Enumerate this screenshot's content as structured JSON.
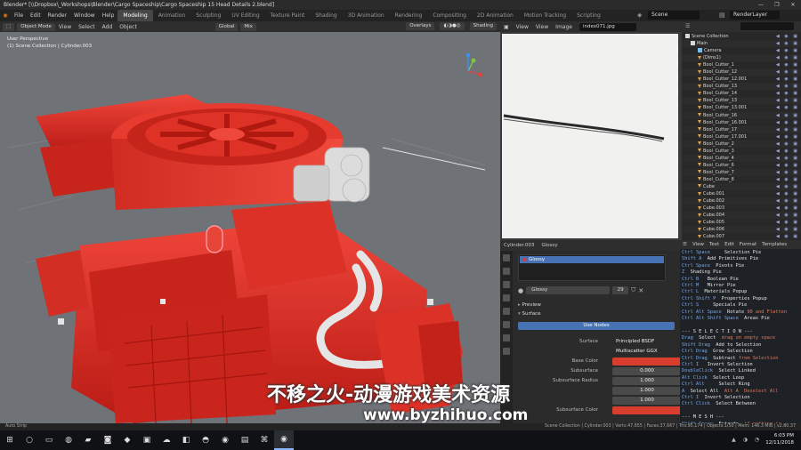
{
  "window": {
    "title": "Blender* [\\\\Dropbox\\_Workshops\\Blender\\Cargo Spaceship\\Cargo Spaceship 15 Head Details 2.blend]",
    "controls": [
      "—",
      "❐",
      "✕"
    ]
  },
  "menu": [
    "File",
    "Edit",
    "Render",
    "Window",
    "Help"
  ],
  "workspaces": [
    "Modeling",
    "Animation",
    "Sculpting",
    "UV Editing",
    "Texture Paint",
    "Shading",
    "3D Animation",
    "Rendering",
    "Compositing",
    "2D Animation",
    "Scripting",
    "Motion Tracking",
    "Scripting"
  ],
  "active_workspace": "Modeling",
  "scene": "Scene",
  "render_layer": "RenderLayer",
  "viewport": {
    "mode": "Object Mode",
    "menus": [
      "View",
      "Select",
      "Add",
      "Object"
    ],
    "transform_orientation": "Global",
    "pivot": "Mix",
    "overlays": "Overlays",
    "shading": "Shading",
    "info_line1": "User Perspective",
    "info_line2": "(1) Scene Collection | Cylinder.003",
    "accent_color": "#e3231b"
  },
  "image_editor": {
    "menus": [
      "View",
      "View",
      "Image"
    ],
    "filename": "index071.jpg"
  },
  "outliner": {
    "items": [
      {
        "label": "Scene Collection",
        "icon": "collection"
      },
      {
        "label": "Main",
        "icon": "collection"
      },
      {
        "label": "Camera",
        "icon": "camera"
      },
      {
        "label": "(Dims1)",
        "icon": "mesh"
      },
      {
        "label": "Bool_Cutter_1",
        "icon": "mesh"
      },
      {
        "label": "Bool_Cutter_12",
        "icon": "mesh"
      },
      {
        "label": "Bool_Cutter_12.001",
        "icon": "mesh"
      },
      {
        "label": "Bool_Cutter_13",
        "icon": "mesh"
      },
      {
        "label": "Bool_Cutter_14",
        "icon": "mesh"
      },
      {
        "label": "Bool_Cutter_13",
        "icon": "mesh"
      },
      {
        "label": "Bool_Cutter_13.001",
        "icon": "mesh"
      },
      {
        "label": "Bool_Cutter_16",
        "icon": "mesh"
      },
      {
        "label": "Bool_Cutter_16.001",
        "icon": "mesh"
      },
      {
        "label": "Bool_Cutter_17",
        "icon": "mesh"
      },
      {
        "label": "Bool_Cutter_17.001",
        "icon": "mesh"
      },
      {
        "label": "Bool_Cutter_2",
        "icon": "mesh"
      },
      {
        "label": "Bool_Cutter_3",
        "icon": "mesh"
      },
      {
        "label": "Bool_Cutter_4",
        "icon": "mesh"
      },
      {
        "label": "Bool_Cutter_6",
        "icon": "mesh"
      },
      {
        "label": "Bool_Cutter_7",
        "icon": "mesh"
      },
      {
        "label": "Bool_Cutter_8",
        "icon": "mesh"
      },
      {
        "label": "Cube",
        "icon": "mesh"
      },
      {
        "label": "Cube.001",
        "icon": "mesh"
      },
      {
        "label": "Cube.002",
        "icon": "mesh"
      },
      {
        "label": "Cube.003",
        "icon": "mesh"
      },
      {
        "label": "Cube.004",
        "icon": "mesh"
      },
      {
        "label": "Cube.005",
        "icon": "mesh"
      },
      {
        "label": "Cube.006",
        "icon": "mesh"
      },
      {
        "label": "Cube.007",
        "icon": "mesh"
      }
    ]
  },
  "properties": {
    "breadcrumb_object": "Cylinder.003",
    "breadcrumb_material": "Glossy",
    "slot_name": "Glossy",
    "material_name": "Glossy",
    "users": "29",
    "sections": {
      "preview": "Preview",
      "surface": "Surface"
    },
    "use_nodes": "Use Nodes",
    "rows": [
      {
        "label": "Surface",
        "value": "Principled BSDF",
        "kind": "dd"
      },
      {
        "label": "",
        "value": "Multiscatter GGX",
        "kind": "dd"
      },
      {
        "label": "Base Color",
        "value": "",
        "kind": "red"
      },
      {
        "label": "Subsurface",
        "value": "0.000",
        "kind": "num"
      },
      {
        "label": "Subsurface Radius",
        "value": "1.000",
        "kind": "num"
      },
      {
        "label": "",
        "value": "1.000",
        "kind": "num"
      },
      {
        "label": "",
        "value": "1.000",
        "kind": "num"
      },
      {
        "label": "Subsurface Color",
        "value": "",
        "kind": "red"
      }
    ]
  },
  "text_editor": {
    "menus": [
      "View",
      "Text",
      "Edit",
      "Format",
      "Templates"
    ],
    "lines": [
      {
        "k": "Ctrl Space",
        "t": "     Selection Pie",
        "r": ""
      },
      {
        "k": "Shift A",
        "t": "  Add Primitives Pie",
        "r": ""
      },
      {
        "k": "Ctrl Space",
        "t": "  Pivots Pie",
        "r": ""
      },
      {
        "k": "Z",
        "t": "  Shading Pie",
        "r": ""
      },
      {
        "k": "Ctrl B",
        "t": "   Boolean Pie",
        "r": ""
      },
      {
        "k": "Ctrl M",
        "t": "   Mirror Pie",
        "r": ""
      },
      {
        "k": "Ctrl L",
        "t": "  Materials Popup",
        "r": ""
      },
      {
        "k": "Ctrl Shift P",
        "t": "  Properties Popup",
        "r": ""
      },
      {
        "k": "Ctrl S",
        "t": "     Specials Pie",
        "r": ""
      },
      {
        "k": "Ctrl Alt Space",
        "t": "  Rotate ",
        "r": "90 and Flatten"
      },
      {
        "k": "Ctrl Alt Shift Space",
        "t": "  Areas Pie",
        "r": ""
      },
      {
        "k": "",
        "t": "",
        "r": ""
      },
      {
        "k": "",
        "t": "--- S E L E C T I O N ---",
        "r": ""
      },
      {
        "k": "Drag",
        "t": "  Select  ",
        "r": "drag on empty space"
      },
      {
        "k": "Shift Drag",
        "t": "  Add to Selection",
        "r": ""
      },
      {
        "k": "Ctrl Drag",
        "t": "  Grow Selection",
        "r": ""
      },
      {
        "k": "Ctrl Drag",
        "t": "  Subtract ",
        "r": "from Selection"
      },
      {
        "k": "Ctrl I",
        "t": "   Invert Selection",
        "r": ""
      },
      {
        "k": "DoubleClick",
        "t": "  Select Linked",
        "r": ""
      },
      {
        "k": "Alt Click",
        "t": "  Select Loop",
        "r": ""
      },
      {
        "k": "Ctrl Alt",
        "t": "     Select Ring",
        "r": ""
      },
      {
        "k": "A",
        "t": "  Select All  ",
        "r": "Alt A  Deselect All"
      },
      {
        "k": "Ctrl I",
        "t": "  Invert Selection",
        "r": ""
      },
      {
        "k": "Ctrl Click",
        "t": "  Select Between",
        "r": ""
      },
      {
        "k": "",
        "t": "",
        "r": ""
      },
      {
        "k": "",
        "t": "--- M E S H ---",
        "r": ""
      },
      {
        "k": "Shift Space",
        "t": "  Extrude  ",
        "r": "if nothing is"
      },
      {
        "k": "Alt Space",
        "t": "  Inset",
        "r": ""
      }
    ]
  },
  "status_bar": {
    "left": "Auto Strip",
    "right": "Scene Collection | Cylinder.003 | Verts:47,655 | Faces:37,667 | Tris:95,174 | Objects:1/50 | Mem: 146.3 MiB | v2.80.37"
  },
  "taskbar": {
    "time": "6:03 PM",
    "date": "12/11/2018"
  },
  "watermark": {
    "line1": "不移之火-动漫游戏美术资源",
    "line2": "www.byzhihuo.com"
  }
}
